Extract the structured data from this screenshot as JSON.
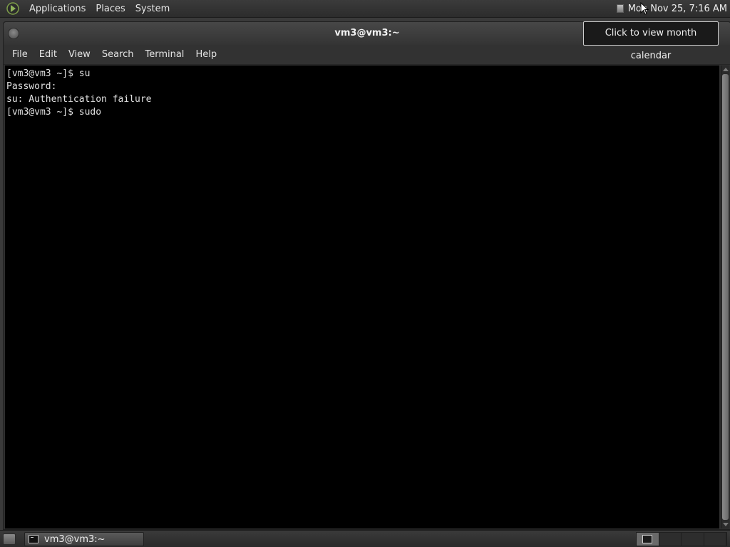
{
  "top_panel": {
    "logo_icon": "distro-logo-icon",
    "menus": [
      "Applications",
      "Places",
      "System"
    ],
    "clock": "Mon Nov 25,  7:16 AM"
  },
  "tooltip": {
    "text": "Click to view month calendar"
  },
  "window": {
    "title": "vm3@vm3:~",
    "menu": [
      "File",
      "Edit",
      "View",
      "Search",
      "Terminal",
      "Help"
    ],
    "terminal_lines": [
      "[vm3@vm3 ~]$ su",
      "Password:",
      "su: Authentication failure",
      "[vm3@vm3 ~]$ sudo"
    ]
  },
  "bottom_panel": {
    "taskbar_item_label": "vm3@vm3:~",
    "workspaces": 4,
    "active_workspace": 1
  },
  "colors": {
    "terminal_bg": "#000000",
    "terminal_fg": "#e0e0e0",
    "panel_bg": "#333333"
  }
}
